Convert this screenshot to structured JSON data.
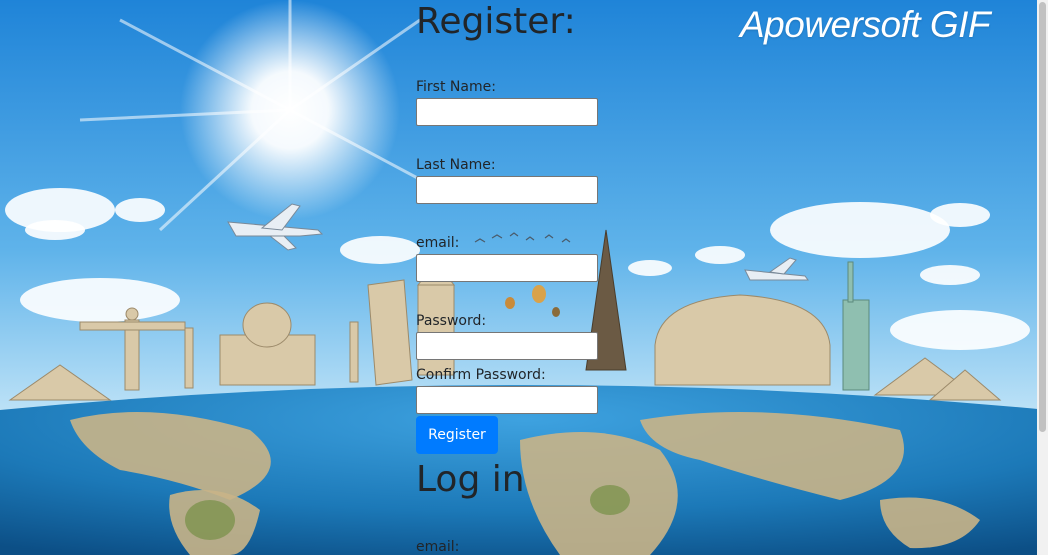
{
  "watermark": "Apowersoft GIF",
  "register": {
    "title": "Register:",
    "first_name_label": "First Name:",
    "last_name_label": "Last Name:",
    "email_label": "email:",
    "password_label": "Password:",
    "confirm_password_label": "Confirm Password:",
    "button_label": "Register"
  },
  "login": {
    "title": "Log in",
    "email_label": "email:"
  },
  "colors": {
    "button": "#007bff",
    "sky_top": "#1f84d8",
    "sky_bottom": "#bfe3f7",
    "ocean": "#1c79b8"
  },
  "icons": [
    "sun-icon",
    "airplane-icon",
    "birds-icon",
    "balloon-icon"
  ]
}
